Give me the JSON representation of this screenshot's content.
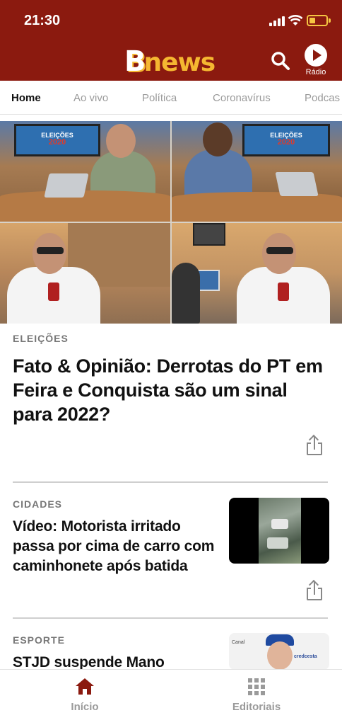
{
  "status_bar": {
    "time": "21:30"
  },
  "header": {
    "logo_b": "B",
    "logo_rest": "news",
    "radio_label": "Rádio"
  },
  "tabs": [
    "Home",
    "Ao vivo",
    "Política",
    "Coronavírus",
    "Podcas"
  ],
  "hero": {
    "screen_line1": "ELEIÇÕES",
    "screen_line2": "2020"
  },
  "featured": {
    "kicker": "ELEIÇÕES",
    "headline": "Fato & Opinião: Derrotas do PT em Feira e Conquista são um sinal para 2022?"
  },
  "news": [
    {
      "kicker": "CIDADES",
      "title": "Vídeo: Motorista irritado passa por cima de carro com caminhonete após batida"
    },
    {
      "kicker": "ESPORTE",
      "title": "STJD suspende Mano"
    }
  ],
  "thumb_texts": {
    "esporte_sign1": "Canal",
    "esporte_sign2": "credcesta"
  },
  "bottom_nav": {
    "home_label": "Início",
    "editorials_label": "Editoriais"
  },
  "colors": {
    "brand": "#8b1a0f",
    "logo_accent": "#f5b731",
    "muted": "#9a9a9a"
  }
}
